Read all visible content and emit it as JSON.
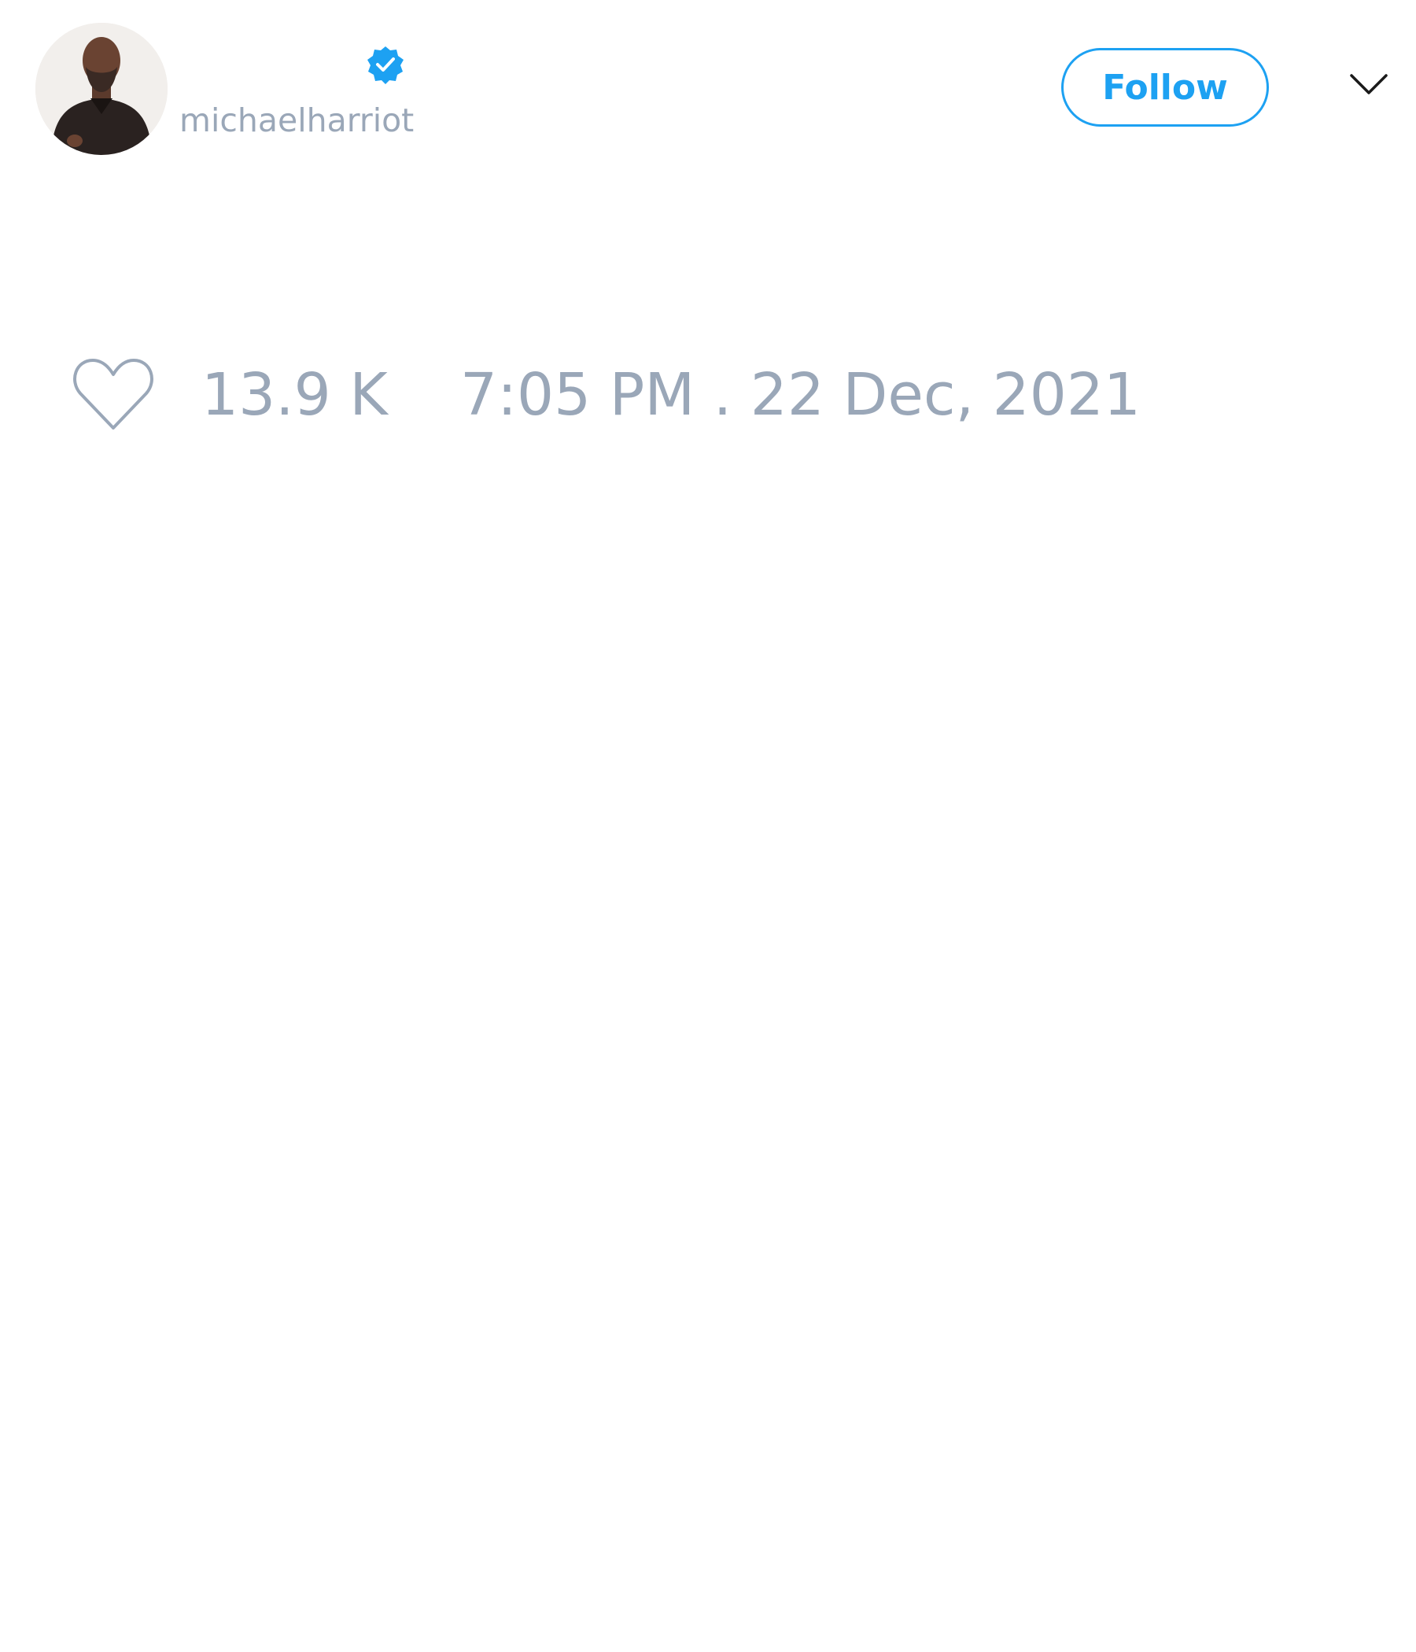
{
  "tweet": {
    "author": {
      "handle": "michaelharriot",
      "verified": true
    },
    "follow_label": "Follow",
    "likes": "13.9 K",
    "timestamp": "7:05 PM . 22 Dec, 2021"
  },
  "icons": {
    "verified": "verified-badge-icon",
    "menu": "chevron-down-icon",
    "like": "heart-icon"
  },
  "colors": {
    "accent": "#1da1f2",
    "muted_text": "#9aa7b8",
    "background": "#ffffff"
  }
}
